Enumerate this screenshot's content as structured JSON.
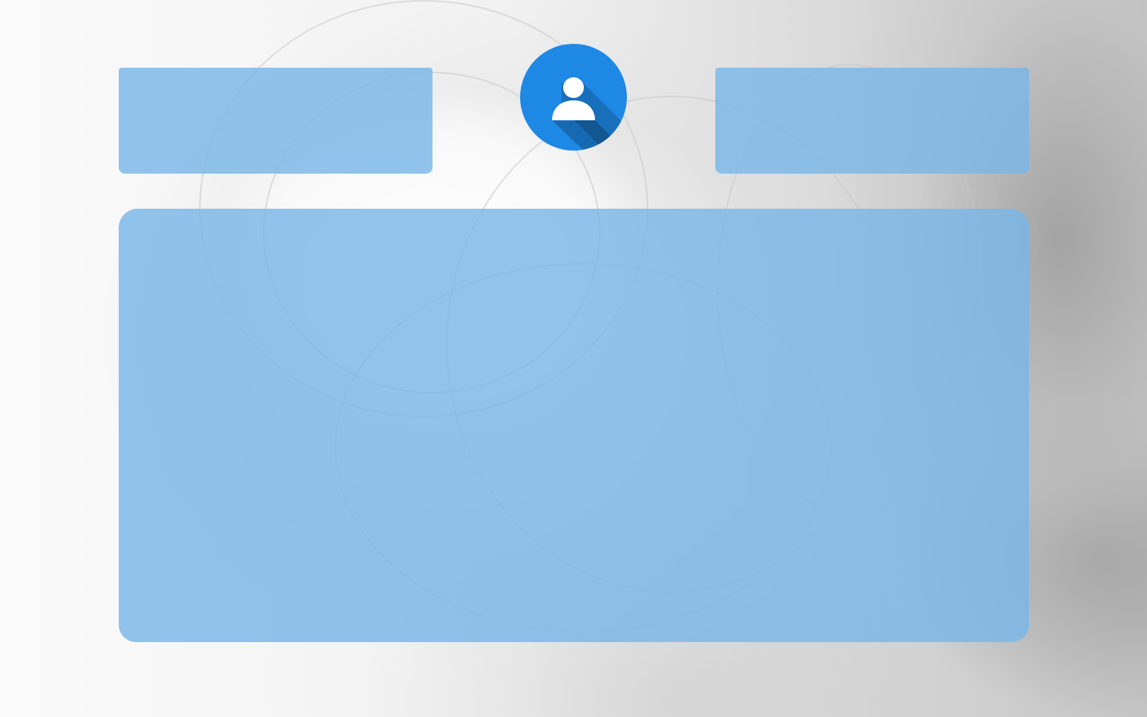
{
  "page": {
    "background_image": "grayscale-rose-photo"
  },
  "panels": {
    "top_left": {
      "color": "#79b7e8"
    },
    "top_right": {
      "color": "#79b7e8"
    },
    "main": {
      "color": "#79b7e8"
    }
  },
  "avatar": {
    "icon": "user-icon",
    "color": "#1e88e5"
  }
}
